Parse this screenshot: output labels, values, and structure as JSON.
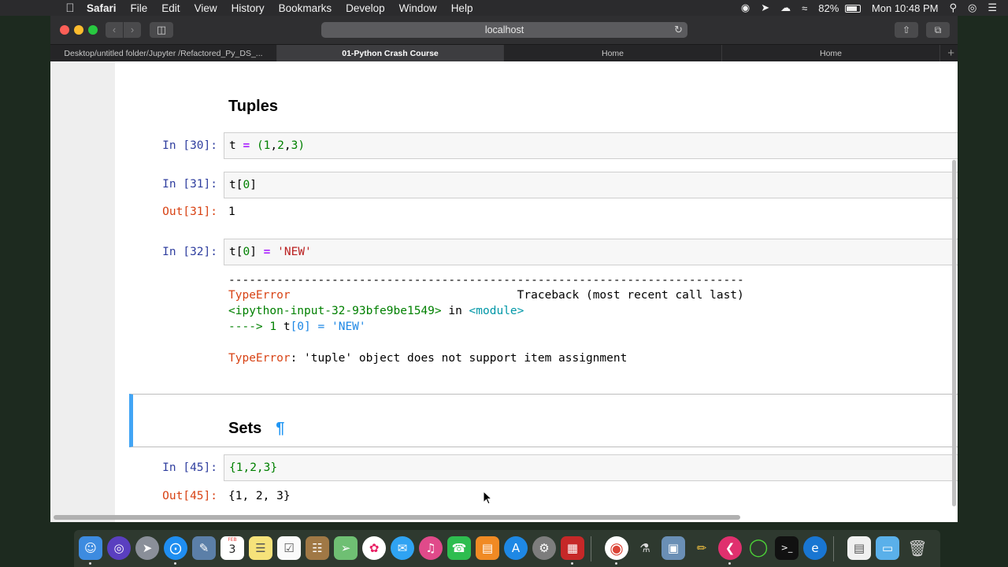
{
  "menubar": {
    "apple": "",
    "app_name": "Safari",
    "items": [
      "File",
      "Edit",
      "View",
      "History",
      "Bookmarks",
      "Develop",
      "Window",
      "Help"
    ],
    "battery_percent": "82%",
    "clock": "Mon 10:48 PM"
  },
  "browser": {
    "address": "localhost",
    "tabs": [
      {
        "label": "Desktop/untitled folder/Jupyter /Refactored_Py_DS_...",
        "active": false
      },
      {
        "label": "01-Python Crash Course",
        "active": true
      },
      {
        "label": "Home",
        "active": false
      },
      {
        "label": "Home",
        "active": false
      }
    ],
    "new_tab": "+"
  },
  "notebook": {
    "tuples_heading": "Tuples",
    "cells": [
      {
        "prompt": "In [30]:",
        "code": [
          "t ",
          "=",
          " ",
          "(",
          "1",
          ",",
          "2",
          ",",
          "3",
          ")"
        ]
      },
      {
        "prompt": "In [31]:",
        "code": [
          "t",
          "[",
          "0",
          "]"
        ],
        "out_prompt": "Out[31]:",
        "output": "1"
      },
      {
        "prompt": "In [32]:",
        "code": [
          "t",
          "[",
          "0",
          "]",
          " ",
          "=",
          " ",
          "'NEW'"
        ]
      }
    ],
    "traceback": {
      "rule": "---------------------------------------------------------------------------",
      "error_type": "TypeError",
      "traceback_header": "Traceback (most recent call last)",
      "input_ref": "<ipython-input-32-93bfe9be1549>",
      "in_word": " in ",
      "module": "<module>",
      "arrow": "----> 1 ",
      "line_code_t": "t",
      "line_code_idx": "[0]",
      "line_code_eq": " = ",
      "line_code_str": "'NEW'",
      "final_error_type": "TypeError",
      "final_message": ": 'tuple' object does not support item assignment"
    },
    "sets_heading": "Sets",
    "pilcrow": "¶",
    "sets_cell": {
      "prompt": "In [45]:",
      "code": "{1,2,3}",
      "out_prompt": "Out[45]:",
      "output": "{1, 2, 3}"
    }
  },
  "dock": {
    "icons": [
      "finder-icon",
      "siri-icon",
      "launchpad-icon",
      "safari-icon",
      "preview-icon",
      "calendar-icon",
      "notes-icon",
      "reminders-icon",
      "contacts-icon",
      "maps-icon",
      "photos-icon",
      "messages-icon",
      "itunes-icon",
      "facetime-icon",
      "ibooks-icon",
      "app-store-icon",
      "system-preferences-icon",
      "app-red-icon",
      "chrome-icon",
      "script-editor-icon",
      "image-capture-icon",
      "pencil-icon",
      "kite-icon",
      "green-circle-icon",
      "terminal-icon",
      "edge-icon",
      "documents-icon",
      "folder-icon",
      "trash-icon"
    ],
    "calendar_date": "3",
    "calendar_month": "FEB"
  },
  "colors": {
    "prompt_in": "#303f9f",
    "prompt_out": "#d84315",
    "selected_cell_border": "#42a5f5"
  }
}
